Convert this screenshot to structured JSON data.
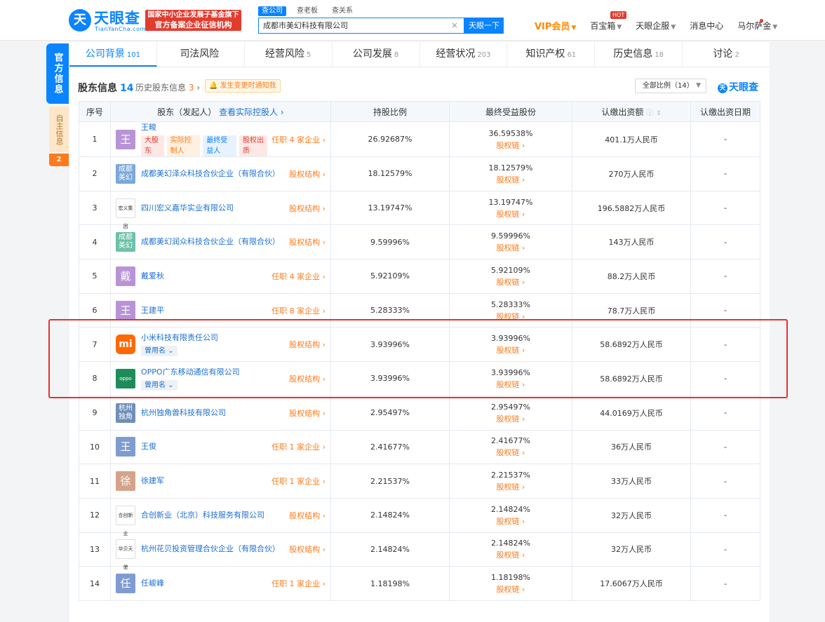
{
  "header": {
    "logo_text": "天眼查",
    "logo_sub": "TianYanCha.com",
    "gov_badge_line1": "国家中小企业发展子基金旗下",
    "gov_badge_line2": "官方备案企业征信机构",
    "search_tabs": [
      "查公司",
      "查老板",
      "查关系"
    ],
    "search_value": "成都市美幻科技有限公司",
    "search_btn": "天眼一下",
    "nav": [
      {
        "label": "VIP会员"
      },
      {
        "label": "百宝箱"
      },
      {
        "label": "天眼企服"
      },
      {
        "label": "消息中心"
      },
      {
        "label": "马尔萨金"
      }
    ],
    "hot": "HOT"
  },
  "side": {
    "tab1": "官方信息",
    "tab2": "自主信息",
    "count": "2"
  },
  "tabs": [
    {
      "label": "公司背景",
      "count": "101"
    },
    {
      "label": "司法风险",
      "count": ""
    },
    {
      "label": "经营风险",
      "count": "5"
    },
    {
      "label": "公司发展",
      "count": "8"
    },
    {
      "label": "经营状况",
      "count": "203"
    },
    {
      "label": "知识产权",
      "count": "61"
    },
    {
      "label": "历史信息",
      "count": "18"
    },
    {
      "label": "讨论",
      "count": "2"
    }
  ],
  "section": {
    "title": "股东信息",
    "count": "14",
    "history": "历史股东信息",
    "history_count": "3",
    "notify": "发生变更时通知我",
    "ratio": "全部比例（14）",
    "brand": "天眼查"
  },
  "columns": [
    "序号",
    "股东（发起人）",
    "查看实际控股人",
    "持股比例",
    "最终受益股份",
    "认缴出资额",
    "认缴出资日期"
  ],
  "equity_link": "股权链",
  "used_name": "曾用名",
  "rows": [
    {
      "no": "1",
      "avatar": "王",
      "color": "#b894d6",
      "name": "王畯",
      "right": "任职 4 家企业",
      "tags": [
        "大股东",
        "实际控制人",
        "最终受益人",
        "股权出质"
      ],
      "ratio": "26.92687%",
      "benefit": "36.59538%",
      "amount": "401.1万人民币",
      "date": "-"
    },
    {
      "no": "2",
      "avatar": "成都美幻",
      "color": "#7aa8d9",
      "name": "成都美幻泽众科技合伙企业（有限合伙）",
      "right": "股权结构",
      "ratio": "18.12579%",
      "benefit": "18.12579%",
      "amount": "270万人民币",
      "date": "-"
    },
    {
      "no": "3",
      "avatar": "宏义集团",
      "color": "logo",
      "name": "四川宏义嘉华实业有限公司",
      "right": "股权结构",
      "ratio": "13.19747%",
      "benefit": "13.19747%",
      "amount": "196.5882万人民币",
      "date": "-"
    },
    {
      "no": "4",
      "avatar": "成都美幻",
      "color": "#6cc1a8",
      "name": "成都美幻润众科技合伙企业（有限合伙）",
      "right": "股权结构",
      "ratio": "9.59996%",
      "benefit": "9.59996%",
      "amount": "143万人民币",
      "date": "-"
    },
    {
      "no": "5",
      "avatar": "戴",
      "color": "#b894d6",
      "name": "戴爱秋",
      "right": "任职 4 家企业",
      "ratio": "5.92109%",
      "benefit": "5.92109%",
      "amount": "88.2万人民币",
      "date": "-"
    },
    {
      "no": "6",
      "avatar": "王",
      "color": "#b894d6",
      "name": "王建平",
      "right": "任职 8 家企业",
      "ratio": "5.28333%",
      "benefit": "5.28333%",
      "amount": "78.7万人民币",
      "date": "-"
    },
    {
      "no": "7",
      "avatar": "mi",
      "color": "#ff6900",
      "name": "小米科技有限责任公司",
      "right": "股权结构",
      "used": true,
      "ratio": "3.93996%",
      "benefit": "3.93996%",
      "amount": "58.6892万人民币",
      "date": "-"
    },
    {
      "no": "8",
      "avatar": "oppo",
      "color": "#1e8c5a",
      "name": "OPPO广东移动通信有限公司",
      "right": "股权结构",
      "used": true,
      "ratio": "3.93996%",
      "benefit": "3.93996%",
      "amount": "58.6892万人民币",
      "date": "-"
    },
    {
      "no": "9",
      "avatar": "杭州独角",
      "color": "#6f8fb8",
      "name": "杭州独角兽科技有限公司",
      "right": "股权结构",
      "ratio": "2.95497%",
      "benefit": "2.95497%",
      "amount": "44.0169万人民币",
      "date": "-"
    },
    {
      "no": "10",
      "avatar": "王",
      "color": "#7f9cd0",
      "name": "王俊",
      "right": "任职 1 家企业",
      "ratio": "2.41677%",
      "benefit": "2.41677%",
      "amount": "36万人民币",
      "date": "-"
    },
    {
      "no": "11",
      "avatar": "徐",
      "color": "#d4a38a",
      "name": "徐建军",
      "right": "任职 1 家企业",
      "ratio": "2.21537%",
      "benefit": "2.21537%",
      "amount": "33万人民币",
      "date": "-"
    },
    {
      "no": "12",
      "avatar": "合创新业",
      "color": "logo",
      "name": "合创新业（北京）科技服务有限公司",
      "right": "股权结构",
      "ratio": "2.14824%",
      "benefit": "2.14824%",
      "amount": "32万人民币",
      "date": "-"
    },
    {
      "no": "13",
      "avatar": "华贝天使",
      "color": "logo",
      "name": "杭州花贝投资管理合伙企业（有限合伙）",
      "right": "股权结构",
      "ratio": "2.14824%",
      "benefit": "2.14824%",
      "amount": "32万人民币",
      "date": "-"
    },
    {
      "no": "14",
      "avatar": "任",
      "color": "#7f9cd0",
      "name": "任峻峰",
      "right": "任职 1 家企业",
      "ratio": "1.18198%",
      "benefit": "1.18198%",
      "amount": "17.6067万人民币",
      "date": "-"
    }
  ]
}
